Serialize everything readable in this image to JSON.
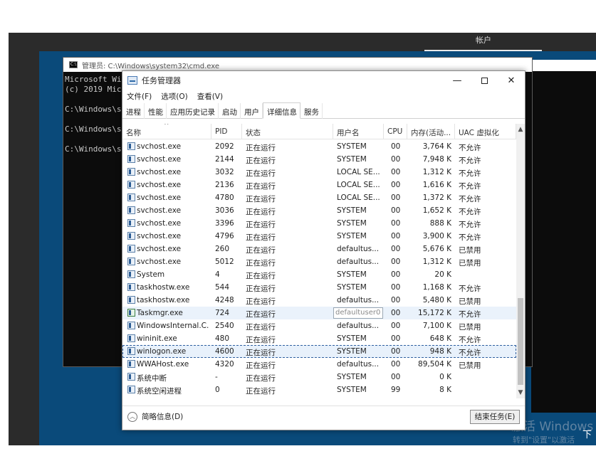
{
  "desktop": {
    "account_tab": "帐户",
    "activation_title": "激活 Windows",
    "activation_subtitle": "转到\"设置\"以激活",
    "corner_mark": "下"
  },
  "cmd": {
    "title": "管理员: C:\\Windows\\system32\\cmd.exe",
    "icon_text": "C:\\",
    "lines": [
      "Microsoft Wi",
      "(c) 2019 Mic",
      "",
      "C:\\Windows\\s",
      "",
      "C:\\Windows\\s",
      "",
      "C:\\Windows\\s"
    ]
  },
  "taskmgr": {
    "title": "任务管理器",
    "menu": [
      "文件(F)",
      "选项(O)",
      "查看(V)"
    ],
    "tabs": [
      "进程",
      "性能",
      "应用历史记录",
      "启动",
      "用户",
      "详细信息",
      "服务"
    ],
    "active_tab": 5,
    "columns": [
      "名称",
      "PID",
      "状态",
      "用户名",
      "CPU",
      "内存(活动...",
      "UAC 虚拟化"
    ],
    "rows": [
      {
        "name": "svchost.exe",
        "pid": "2092",
        "status": "正在运行",
        "user": "SYSTEM",
        "cpu": "00",
        "mem": "3,764 K",
        "uac": "不允许"
      },
      {
        "name": "svchost.exe",
        "pid": "2144",
        "status": "正在运行",
        "user": "SYSTEM",
        "cpu": "00",
        "mem": "7,948 K",
        "uac": "不允许"
      },
      {
        "name": "svchost.exe",
        "pid": "3032",
        "status": "正在运行",
        "user": "LOCAL SE...",
        "cpu": "00",
        "mem": "1,312 K",
        "uac": "不允许"
      },
      {
        "name": "svchost.exe",
        "pid": "2136",
        "status": "正在运行",
        "user": "LOCAL SE...",
        "cpu": "00",
        "mem": "1,616 K",
        "uac": "不允许"
      },
      {
        "name": "svchost.exe",
        "pid": "4780",
        "status": "正在运行",
        "user": "LOCAL SE...",
        "cpu": "00",
        "mem": "1,372 K",
        "uac": "不允许"
      },
      {
        "name": "svchost.exe",
        "pid": "3036",
        "status": "正在运行",
        "user": "SYSTEM",
        "cpu": "00",
        "mem": "1,652 K",
        "uac": "不允许"
      },
      {
        "name": "svchost.exe",
        "pid": "3396",
        "status": "正在运行",
        "user": "SYSTEM",
        "cpu": "00",
        "mem": "888 K",
        "uac": "不允许"
      },
      {
        "name": "svchost.exe",
        "pid": "4796",
        "status": "正在运行",
        "user": "SYSTEM",
        "cpu": "00",
        "mem": "3,900 K",
        "uac": "不允许"
      },
      {
        "name": "svchost.exe",
        "pid": "260",
        "status": "正在运行",
        "user": "defaultus...",
        "cpu": "00",
        "mem": "5,676 K",
        "uac": "已禁用"
      },
      {
        "name": "svchost.exe",
        "pid": "5012",
        "status": "正在运行",
        "user": "defaultus...",
        "cpu": "00",
        "mem": "1,312 K",
        "uac": "已禁用"
      },
      {
        "name": "System",
        "pid": "4",
        "status": "正在运行",
        "user": "SYSTEM",
        "cpu": "00",
        "mem": "20 K",
        "uac": ""
      },
      {
        "name": "taskhostw.exe",
        "pid": "544",
        "status": "正在运行",
        "user": "SYSTEM",
        "cpu": "00",
        "mem": "1,168 K",
        "uac": "不允许"
      },
      {
        "name": "taskhostw.exe",
        "pid": "4248",
        "status": "正在运行",
        "user": "defaultus...",
        "cpu": "00",
        "mem": "5,480 K",
        "uac": "已禁用"
      },
      {
        "name": "Taskmgr.exe",
        "pid": "724",
        "status": "正在运行",
        "user": "defaultuser0",
        "cpu": "00",
        "mem": "15,172 K",
        "uac": "不允许"
      },
      {
        "name": "WindowsInternal.C...",
        "pid": "2540",
        "status": "正在运行",
        "user": "defaultus...",
        "cpu": "00",
        "mem": "7,100 K",
        "uac": "已禁用"
      },
      {
        "name": "wininit.exe",
        "pid": "480",
        "status": "正在运行",
        "user": "SYSTEM",
        "cpu": "00",
        "mem": "648 K",
        "uac": "不允许"
      },
      {
        "name": "winlogon.exe",
        "pid": "4600",
        "status": "正在运行",
        "user": "SYSTEM",
        "cpu": "00",
        "mem": "948 K",
        "uac": "不允许"
      },
      {
        "name": "WWAHost.exe",
        "pid": "4320",
        "status": "正在运行",
        "user": "defaultus...",
        "cpu": "00",
        "mem": "89,504 K",
        "uac": "已禁用"
      },
      {
        "name": "系统中断",
        "pid": "-",
        "status": "正在运行",
        "user": "SYSTEM",
        "cpu": "00",
        "mem": "0 K",
        "uac": ""
      },
      {
        "name": "系统空闲进程",
        "pid": "0",
        "status": "正在运行",
        "user": "SYSTEM",
        "cpu": "99",
        "mem": "8 K",
        "uac": ""
      }
    ],
    "hover_row": 13,
    "selected_row": 16,
    "footer": {
      "fewer_details": "简略信息(D)",
      "end_task": "结束任务(E)"
    }
  }
}
